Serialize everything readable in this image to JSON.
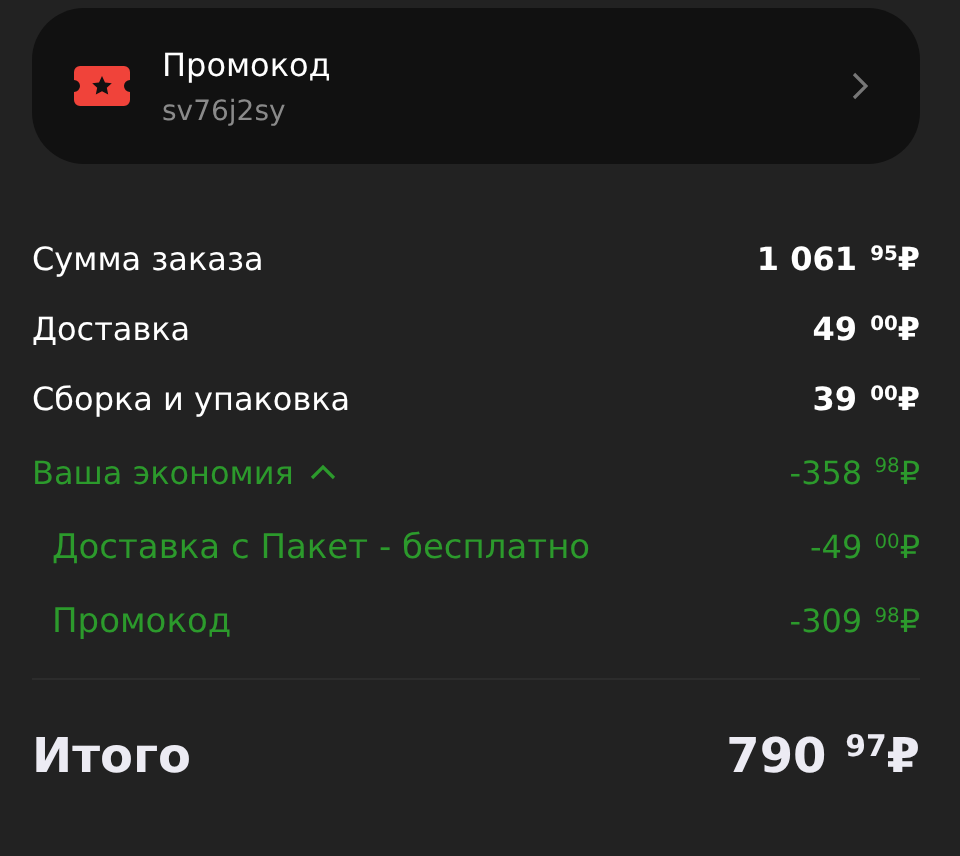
{
  "promo": {
    "title": "Промокод",
    "code": "sv76j2sy"
  },
  "lines": [
    {
      "kind": "regular",
      "label": "Сумма заказа",
      "amount": "1 061 $^{95}$₽"
    },
    {
      "kind": "regular",
      "label": "Доставка",
      "amount": "49 $^{00}$₽"
    },
    {
      "kind": "regular",
      "label": "Сборка и упаковка",
      "amount": "39 $^{00}$₽"
    },
    {
      "kind": "savings",
      "label": "Ваша экономия",
      "amount": "-358 $^{98}$₽",
      "expanded": true
    },
    {
      "kind": "savings-item",
      "label": "Доставка с Пакет - бесплатно",
      "amount": "-49 $^{00}$₽"
    },
    {
      "kind": "savings-item",
      "label": "Промокод",
      "amount": "-309 $^{98}$₽"
    }
  ],
  "total": {
    "label": "Итого",
    "amount": "790 $^{97}$₽"
  }
}
